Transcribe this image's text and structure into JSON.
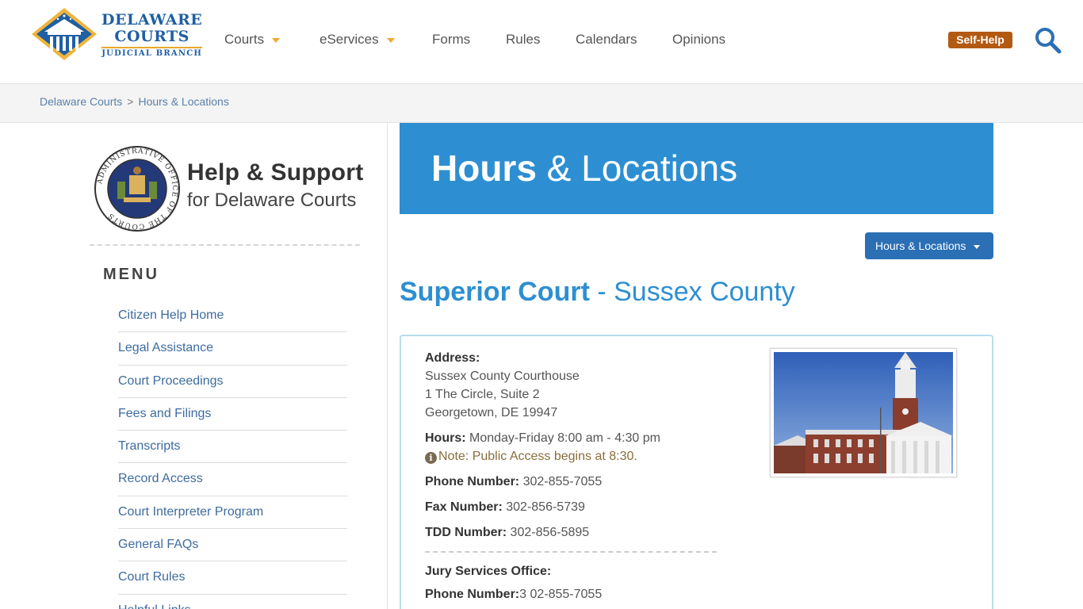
{
  "header": {
    "logo": {
      "line1": "DELAWARE",
      "line2": "COURTS",
      "line3": "JUDICIAL BRANCH"
    },
    "nav": [
      {
        "label": "Courts",
        "has_dropdown": true
      },
      {
        "label": "eServices",
        "has_dropdown": true
      },
      {
        "label": "Forms",
        "has_dropdown": false
      },
      {
        "label": "Rules",
        "has_dropdown": false
      },
      {
        "label": "Calendars",
        "has_dropdown": false
      },
      {
        "label": "Opinions",
        "has_dropdown": false
      }
    ],
    "self_help_label": "Self-Help",
    "search_icon": "search-icon"
  },
  "breadcrumb": {
    "items": [
      "Delaware Courts",
      "Hours & Locations"
    ],
    "separator": ">"
  },
  "sidebar": {
    "title": "Help & Support",
    "subtitle": "for Delaware Courts",
    "seal_text": "ADMINISTRATIVE OFFICE OF THE COURTS",
    "menu_heading": "MENU",
    "menu": [
      "Citizen Help Home",
      "Legal Assistance",
      "Court Proceedings",
      "Fees and Filings",
      "Transcripts",
      "Record Access",
      "Court Interpreter Program",
      "General FAQs",
      "Court Rules",
      "Helpful Links"
    ]
  },
  "main": {
    "banner": {
      "bold": "Hours",
      "rest": " & Locations"
    },
    "dropdown_label": "Hours & Locations",
    "court": {
      "name": "Superior Court",
      "county": " - Sussex County"
    },
    "address_label": "Address:",
    "address_lines": [
      "Sussex County Courthouse",
      "1 The Circle, Suite 2",
      "Georgetown, DE 19947"
    ],
    "hours_label": "Hours:",
    "hours_value": " Monday-Friday 8:00 am - 4:30 pm",
    "note": "Note: Public Access begins at 8:30.",
    "phone_label": "Phone Number:",
    "phone_value": " 302-855-7055",
    "fax_label": "Fax Number:",
    "fax_value": " 302-856-5739",
    "tdd_label": "TDD Number:",
    "tdd_value": " 302-856-5895",
    "jury_label": "Jury Services Office:",
    "jury_phone_label": "Phone Number:",
    "jury_phone_value": "3 02-855-7055"
  },
  "colors": {
    "brand_blue": "#2d8fd1",
    "button_blue": "#2b6fb5",
    "self_help": "#b35a12",
    "accent_gold": "#f0a830"
  }
}
